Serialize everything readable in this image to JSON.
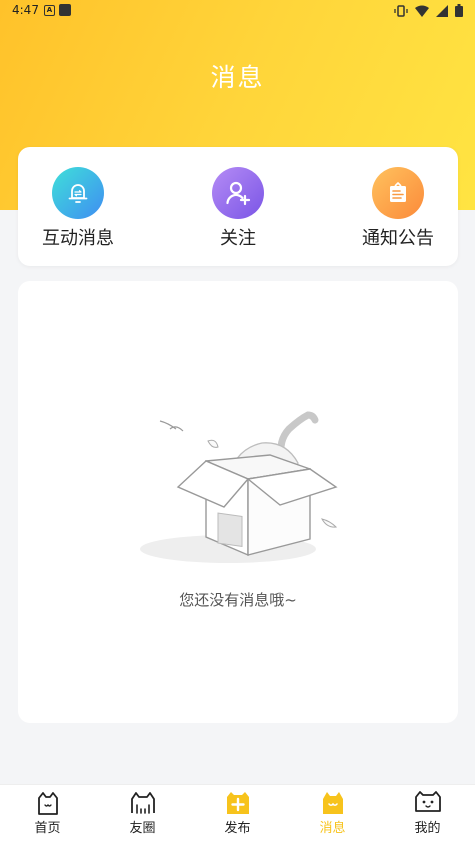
{
  "status_bar": {
    "time": "4:47",
    "notif_letter": "A"
  },
  "header": {
    "title": "消息"
  },
  "quick_entries": [
    {
      "label": "互动消息",
      "icon": "bell-icon"
    },
    {
      "label": "关注",
      "icon": "add-user-icon"
    },
    {
      "label": "通知公告",
      "icon": "notice-board-icon"
    }
  ],
  "empty_state": {
    "message": "您还没有消息哦~"
  },
  "tabbar": {
    "items": [
      {
        "label": "首页",
        "icon": "cat-home-icon"
      },
      {
        "label": "友圈",
        "icon": "cat-friends-icon"
      },
      {
        "label": "发布",
        "icon": "publish-plus-icon"
      },
      {
        "label": "消息",
        "icon": "cat-message-icon"
      },
      {
        "label": "我的",
        "icon": "cat-profile-icon"
      }
    ],
    "active_index": 3,
    "active_color": "#f7c31c"
  },
  "colors": {
    "header_gradient_start": "#ffc22a",
    "header_gradient_end": "#ffe442"
  }
}
